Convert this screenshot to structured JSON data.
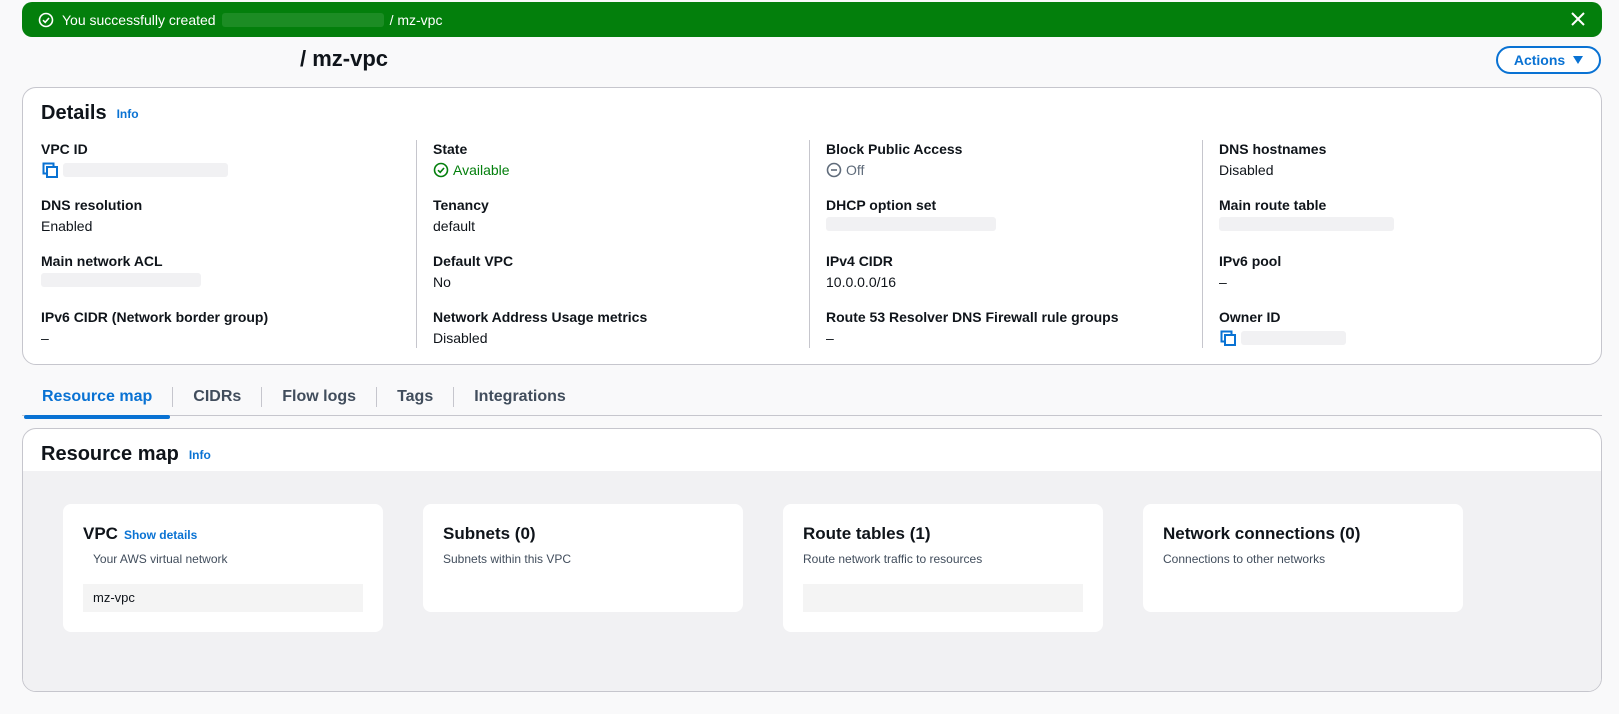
{
  "banner": {
    "prefix": "You successfully created",
    "suffix": "/ mz-vpc"
  },
  "page": {
    "title": "/ mz-vpc",
    "actions_label": "Actions"
  },
  "details": {
    "title": "Details",
    "info": "Info",
    "columns": [
      [
        {
          "label": "VPC ID",
          "value": ""
        },
        {
          "label": "DNS resolution",
          "value": "Enabled"
        },
        {
          "label": "Main network ACL",
          "value": ""
        },
        {
          "label": "IPv6 CIDR (Network border group)",
          "value": "–"
        }
      ],
      [
        {
          "label": "State",
          "value": "Available"
        },
        {
          "label": "Tenancy",
          "value": "default"
        },
        {
          "label": "Default VPC",
          "value": "No"
        },
        {
          "label": "Network Address Usage metrics",
          "value": "Disabled"
        }
      ],
      [
        {
          "label": "Block Public Access",
          "value": "Off"
        },
        {
          "label": "DHCP option set",
          "value": ""
        },
        {
          "label": "IPv4 CIDR",
          "value": "10.0.0.0/16"
        },
        {
          "label": "Route 53 Resolver DNS Firewall rule groups",
          "value": "–"
        }
      ],
      [
        {
          "label": "DNS hostnames",
          "value": "Disabled"
        },
        {
          "label": "Main route table",
          "value": ""
        },
        {
          "label": "IPv6 pool",
          "value": "–"
        },
        {
          "label": "Owner ID",
          "value": ""
        }
      ]
    ]
  },
  "tabs": [
    "Resource map",
    "CIDRs",
    "Flow logs",
    "Tags",
    "Integrations"
  ],
  "resource_map": {
    "title": "Resource map",
    "info": "Info",
    "cards": [
      {
        "title": "VPC",
        "link": "Show details",
        "subtitle": "Your AWS virtual network",
        "item": "mz-vpc"
      },
      {
        "title": "Subnets (0)",
        "subtitle": "Subnets within this VPC"
      },
      {
        "title": "Route tables (1)",
        "subtitle": "Route network traffic to resources",
        "item": ""
      },
      {
        "title": "Network connections (0)",
        "subtitle": "Connections to other networks"
      }
    ]
  },
  "colors": {
    "success": "#037f0c",
    "link": "#0972d3",
    "border": "#c6c6cd"
  }
}
